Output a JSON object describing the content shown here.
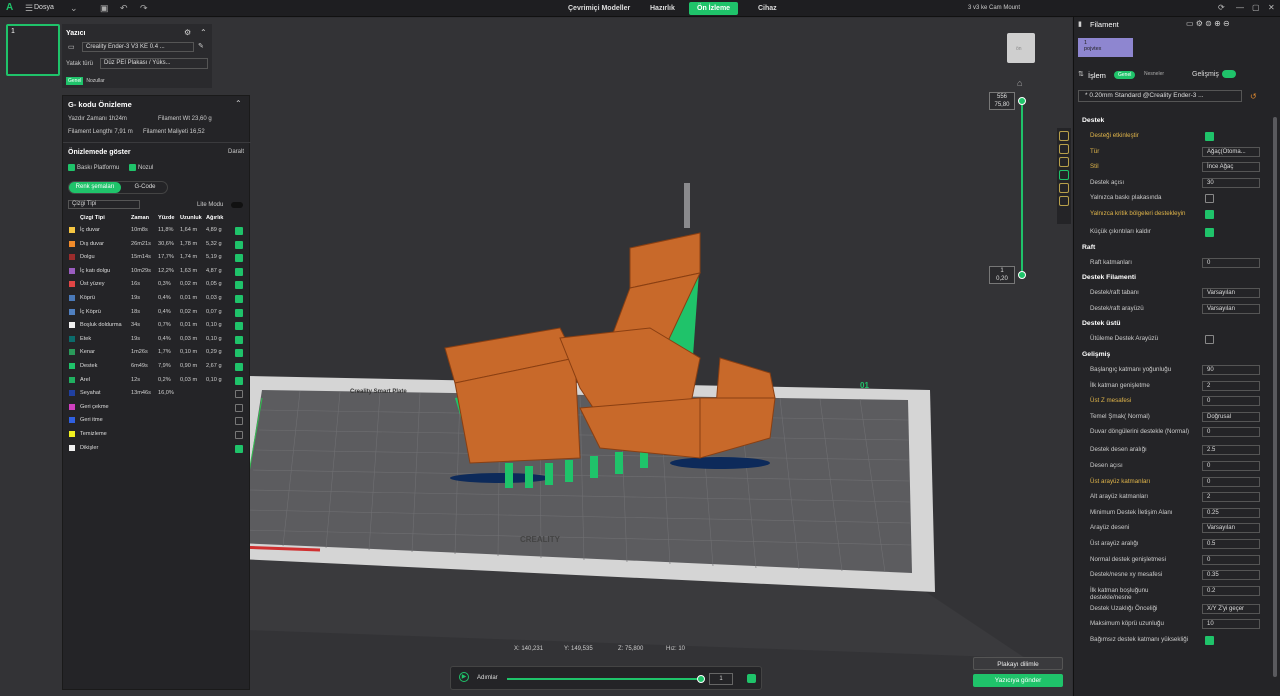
{
  "topbar": {
    "file": "Dosya",
    "nav": [
      "Çevrimiçi Modeller",
      "Hazırlık",
      "Ön İzleme",
      "Cihaz"
    ],
    "title": "3 v3 ke Cam Mount"
  },
  "plate": {
    "num": "1"
  },
  "printer": {
    "title": "Yazıcı",
    "name": "Creality Ender-3 V3 KE 0.4 ...",
    "bed_label": "Yatak türü",
    "bed": "Düz PEI Plakası / Yüks...",
    "tabs": [
      "Genel",
      "Nozullar"
    ]
  },
  "gcode": {
    "title": "G- kodu Önizleme",
    "print_time": "Yazdır Zamanı 1h24m",
    "filament_weight": "Filament Wt 23,60 g",
    "filament_length": "Filament Lengthı 7,91 m",
    "filament_cost": "Filament Maliyeti 16,52",
    "show_title": "Önizlemede göster",
    "collapse": "Daralt",
    "cb1": "Baskı Platformu",
    "cb2": "Nozul",
    "tab_a": "Renk şemaları",
    "tab_b": "G-Code",
    "line_type": "Çizgi Tipi",
    "lite": "Lite Modu",
    "headers": [
      "Çizgi Tipi",
      "Zaman",
      "Yüzde",
      "Uzunluk",
      "Ağırlık"
    ],
    "rows": [
      {
        "name": "İç duvar",
        "time": "10m8s",
        "pct": "11,8%",
        "len": "1,64 m",
        "w": "4,89 g",
        "color": "#f5c542",
        "checked": true
      },
      {
        "name": "Dış duvar",
        "time": "26m21s",
        "pct": "30,6%",
        "len": "1,78 m",
        "w": "5,32 g",
        "color": "#f08a2a",
        "checked": true
      },
      {
        "name": "Dolgu",
        "time": "15m14s",
        "pct": "17,7%",
        "len": "1,74 m",
        "w": "5,19 g",
        "color": "#9b2c2c",
        "checked": true
      },
      {
        "name": "İç katı dolgu",
        "time": "10m29s",
        "pct": "12,2%",
        "len": "1,63 m",
        "w": "4,87 g",
        "color": "#9a5dc0",
        "checked": true
      },
      {
        "name": "Üst yüzey",
        "time": "16s",
        "pct": "0,3%",
        "len": "0,02 m",
        "w": "0,05 g",
        "color": "#e04545",
        "checked": true
      },
      {
        "name": "Köprü",
        "time": "19s",
        "pct": "0,4%",
        "len": "0,01 m",
        "w": "0,03 g",
        "color": "#4a79b8",
        "checked": true
      },
      {
        "name": "İç Köprü",
        "time": "18s",
        "pct": "0,4%",
        "len": "0,02 m",
        "w": "0,07 g",
        "color": "#5080c0",
        "checked": true
      },
      {
        "name": "Boşluk doldurma",
        "time": "34s",
        "pct": "0,7%",
        "len": "0,01 m",
        "w": "0,10 g",
        "color": "#f0f0f0",
        "checked": true
      },
      {
        "name": "Etek",
        "time": "19s",
        "pct": "0,4%",
        "len": "0,03 m",
        "w": "0,10 g",
        "color": "#0b6b6b",
        "checked": true
      },
      {
        "name": "Kenar",
        "time": "1m26s",
        "pct": "1,7%",
        "len": "0,10 m",
        "w": "0,29 g",
        "color": "#2a9a5a",
        "checked": true
      },
      {
        "name": "Destek",
        "time": "6m49s",
        "pct": "7,9%",
        "len": "0,90 m",
        "w": "2,67 g",
        "color": "#1fc36a",
        "checked": true
      },
      {
        "name": "Arel",
        "time": "12s",
        "pct": "0,2%",
        "len": "0,03 m",
        "w": "0,10 g",
        "color": "#20b060",
        "checked": true
      },
      {
        "name": "Seyahat",
        "time": "13m46s",
        "pct": "16,0%",
        "len": "",
        "w": "",
        "color": "#2040a0",
        "checked": false
      },
      {
        "name": "Geri çekme",
        "time": "",
        "pct": "",
        "len": "",
        "w": "",
        "color": "#d040c0",
        "checked": false
      },
      {
        "name": "Geri itme",
        "time": "",
        "pct": "",
        "len": "",
        "w": "",
        "color": "#3060e0",
        "checked": false
      },
      {
        "name": "Temizleme",
        "time": "",
        "pct": "",
        "len": "",
        "w": "",
        "color": "#f0f020",
        "checked": false
      },
      {
        "name": "Dikişler",
        "time": "",
        "pct": "",
        "len": "",
        "w": "",
        "color": "#f0f0f0",
        "checked": true
      }
    ]
  },
  "slider": {
    "top1": "556",
    "top2": "75,80",
    "bot1": "1",
    "bot2": "0,20"
  },
  "coords": {
    "x": "X: 140,231",
    "y": "Y: 149,535",
    "z": "Z: 75,800",
    "speed": "Hız: 10"
  },
  "layerbar": {
    "label": "Adımlar",
    "value": "1"
  },
  "buttons": {
    "slice": "Plakayı dilimle",
    "send": "Yazıcıya gönder"
  },
  "right": {
    "filament": "Filament",
    "fil_num": "1",
    "fil_type": "pojvtex",
    "process": "İşlem",
    "p_tab_a": "Genel",
    "p_tab_b": "Nesneler",
    "advanced": "Gelişmiş",
    "profile": "* 0.20mm Standard @Creality Ender-3 ...",
    "sections": [
      "Destek",
      "Raft",
      "Destek Filamenti",
      "Destek üstü",
      "Gelişmiş"
    ],
    "items": [
      {
        "label": "Desteği etkinleştir",
        "kind": "check",
        "on": true,
        "y": true
      },
      {
        "label": "Tür",
        "kind": "sel",
        "value": "Ağaç(Otoma...",
        "y": true
      },
      {
        "label": "Stil",
        "kind": "sel",
        "value": "İnce Ağaç",
        "y": true
      },
      {
        "label": "Destek açısı",
        "kind": "val",
        "value": "30",
        "y": false
      },
      {
        "label": "Yalnızca baskı plakasında",
        "kind": "check",
        "on": false,
        "y": false
      },
      {
        "label": "Yalnızca kritik bölgeleri destekleyin",
        "kind": "check",
        "on": true,
        "y": true
      },
      {
        "label": "Küçük çıkıntıları kaldır",
        "kind": "check",
        "on": true,
        "y": false
      },
      {
        "label": "Raft katmanları",
        "kind": "val",
        "value": "0",
        "y": false
      },
      {
        "label": "Destek/raft tabanı",
        "kind": "sel",
        "value": "Varsayılan",
        "y": false
      },
      {
        "label": "Destek/raft arayüzü",
        "kind": "sel",
        "value": "Varsayılan",
        "y": false
      },
      {
        "label": "Ütüleme Destek Arayüzü",
        "kind": "check",
        "on": false,
        "y": false
      },
      {
        "label": "Başlangıç katmanı yoğunluğu",
        "kind": "val",
        "value": "90",
        "y": false
      },
      {
        "label": "İlk katman genişletme",
        "kind": "val",
        "value": "2",
        "y": false
      },
      {
        "label": "Üst Z mesafesi",
        "kind": "val",
        "value": "0",
        "y": true
      },
      {
        "label": "Temel Şmak( Normal)",
        "kind": "sel",
        "value": "Doğrusal",
        "y": false
      },
      {
        "label": "Duvar döngülerini destekle (Normal)",
        "kind": "val",
        "value": "0",
        "y": false
      },
      {
        "label": "Destek desen aralığı",
        "kind": "val",
        "value": "2.5",
        "y": false
      },
      {
        "label": "Desen açısı",
        "kind": "val",
        "value": "0",
        "y": false
      },
      {
        "label": "Üst arayüz katmanları",
        "kind": "val",
        "value": "0",
        "y": true
      },
      {
        "label": "Alt arayüz katmanları",
        "kind": "val",
        "value": "2",
        "y": false
      },
      {
        "label": "Minimum Destek İletişim Alanı",
        "kind": "val",
        "value": "0.25",
        "y": false
      },
      {
        "label": "Arayüz deseni",
        "kind": "sel",
        "value": "Varsayılan",
        "y": false
      },
      {
        "label": "Üst arayüz aralığı",
        "kind": "val",
        "value": "0.5",
        "y": false
      },
      {
        "label": "Normal destek genişletmesi",
        "kind": "val",
        "value": "0",
        "y": false
      },
      {
        "label": "Destek/nesne xy mesafesi",
        "kind": "val",
        "value": "0.35",
        "y": false
      },
      {
        "label": "İlk katman boşluğunu destekle/nesne",
        "kind": "val",
        "value": "0.2",
        "y": false
      },
      {
        "label": "Destek Uzaklığı Önceliği",
        "kind": "sel",
        "value": "X/Y Z'yi geçer",
        "y": false
      },
      {
        "label": "Maksimum köprü uzunluğu",
        "kind": "val",
        "value": "10",
        "y": false
      },
      {
        "label": "Bağımsız destek katmanı yüksekliği",
        "kind": "check",
        "on": true,
        "y": false
      }
    ]
  },
  "bed_text": {
    "brand": "CREALITY",
    "brand2": "Creality Smart Plate",
    "num": "01"
  }
}
